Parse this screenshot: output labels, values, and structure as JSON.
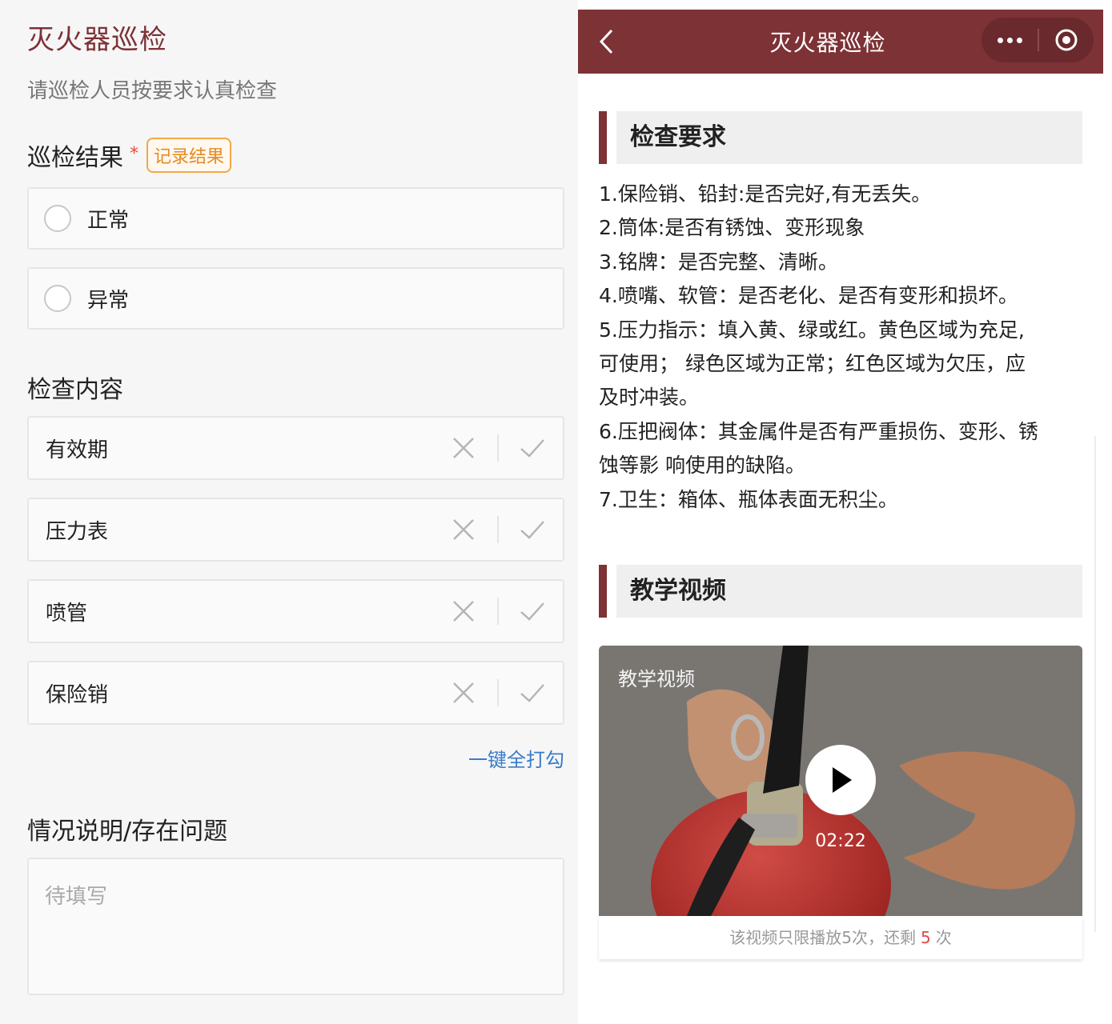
{
  "form": {
    "title": "灭火器巡检",
    "subtitle": "请巡检人员按要求认真检查",
    "result_section": {
      "label": "巡检结果",
      "required_mark": "*",
      "record_button": "记录结果",
      "options": [
        "正常",
        "异常"
      ]
    },
    "check_section": {
      "label": "检查内容",
      "items": [
        "有效期",
        "压力表",
        "喷管",
        "保险销"
      ],
      "check_all": "一键全打勾"
    },
    "remarks_section": {
      "label": "情况说明/存在问题",
      "placeholder": "待填写"
    }
  },
  "mini_program": {
    "nav_title": "灭火器巡检",
    "requirements": {
      "heading": "检查要求",
      "lines": [
        "1.保险销、铅封:是否完好,有无丢失。",
        "2.筒体:是否有锈蚀、变形现象",
        "3.铭牌：是否完整、清晰。",
        "4.喷嘴、软管：是否老化、是否有变形和损坏。",
        "5.压力指示：填入黄、绿或红。黄色区域为充足,",
        "可使用； 绿色区域为正常；红色区域为欠压，应",
        "及时冲装。",
        "6.压把阀体：其金属件是否有严重损伤、变形、锈",
        "蚀等影 响使用的缺陷。",
        "7.卫生：箱体、瓶体表面无积尘。"
      ]
    },
    "video_section": {
      "heading": "教学视频",
      "video_label": "教学视频",
      "duration": "02:22",
      "limit_prefix": "该视频只限播放5次，还剩",
      "remaining": "5",
      "limit_suffix": "次"
    }
  },
  "colors": {
    "brand": "#7d3236",
    "link": "#3a7cc8",
    "tag_orange": "#e68a24",
    "required_red": "#e6473c"
  }
}
